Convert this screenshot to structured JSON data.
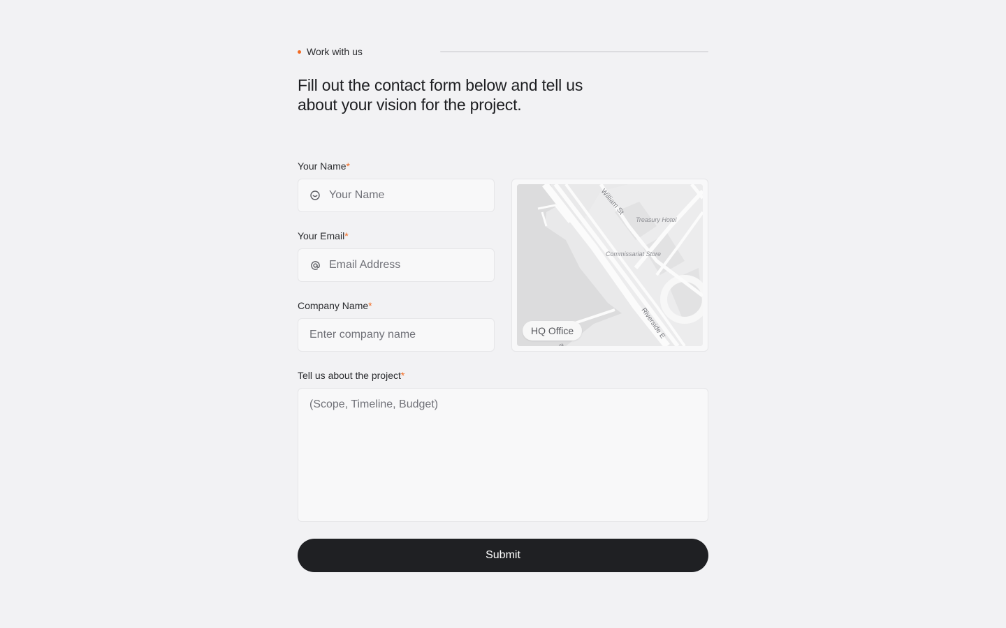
{
  "section": {
    "eyebrow": "Work with us",
    "heading": "Fill out the contact form below and tell us about your vision for the project.",
    "accent_color": "#f26a21"
  },
  "form": {
    "name": {
      "label": "Your Name",
      "required_mark": "*",
      "placeholder": "Your Name",
      "icon": "smiley-icon"
    },
    "email": {
      "label": "Your Email",
      "required_mark": "*",
      "placeholder": "Email Address",
      "icon": "at-sign-icon"
    },
    "company": {
      "label": "Company Name",
      "required_mark": "*",
      "placeholder": "Enter company name"
    },
    "project": {
      "label": "Tell us about the project",
      "required_mark": "*",
      "placeholder": "(Scope, Timeline, Budget)"
    },
    "submit_label": "Submit"
  },
  "map": {
    "pill_label": "HQ Office",
    "street_labels": {
      "william": "William St",
      "riverside": "Riverside E",
      "partial": "a"
    },
    "place_labels": {
      "treasury": "Treasury Hotel",
      "commissariat": "Commissariat Store"
    }
  }
}
